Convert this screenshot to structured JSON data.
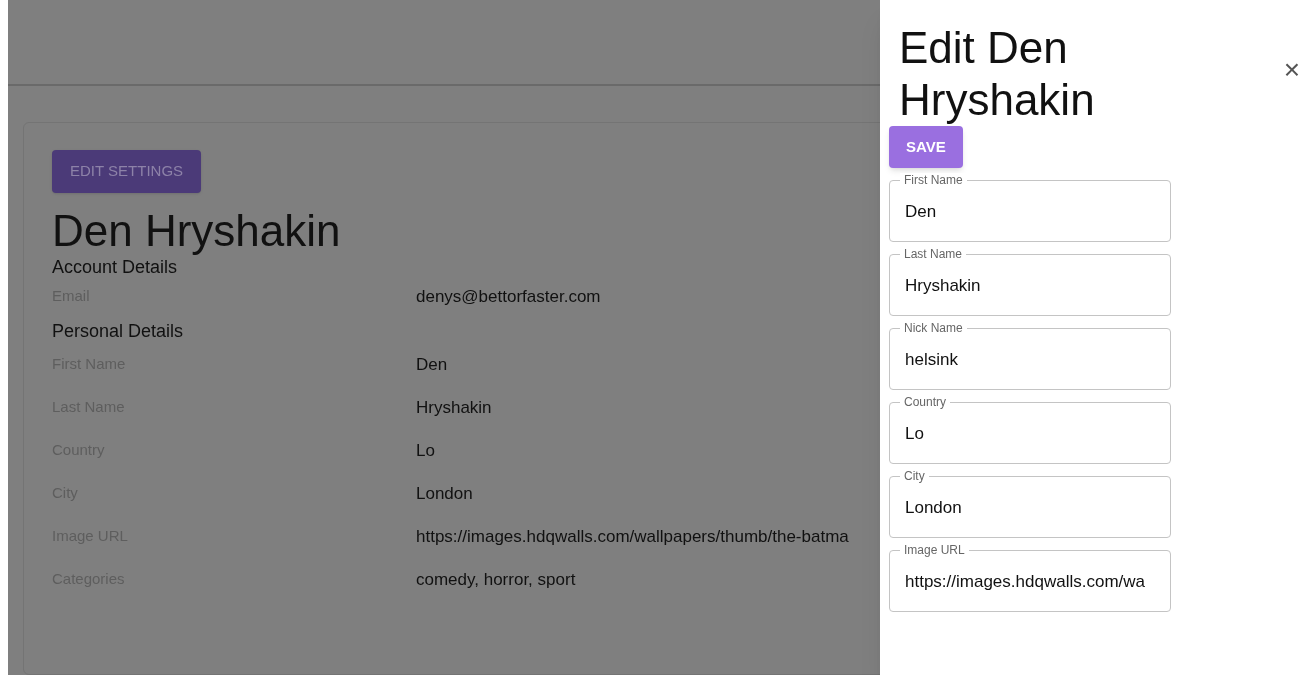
{
  "profile": {
    "edit_button": "EDIT SETTINGS",
    "name": "Den Hryshakin",
    "sections": [
      {
        "title": "Account Details",
        "rows": [
          {
            "label": "Email",
            "value": "denys@bettorfaster.com"
          }
        ]
      },
      {
        "title": "Personal Details",
        "rows": [
          {
            "label": "First Name",
            "value": "Den"
          },
          {
            "label": "Last Name",
            "value": "Hryshakin"
          },
          {
            "label": "Country",
            "value": "Lo"
          },
          {
            "label": "City",
            "value": "London"
          },
          {
            "label": "Image URL",
            "value": "https://images.hdqwalls.com/wallpapers/thumb/the-batma"
          },
          {
            "label": "Categories",
            "value": "comedy, horror, sport"
          }
        ]
      }
    ]
  },
  "drawer": {
    "title": "Edit Den Hryshakin",
    "close": "×",
    "save_button": "SAVE",
    "fields": [
      {
        "label": "First Name",
        "value": "Den"
      },
      {
        "label": "Last Name",
        "value": "Hryshakin"
      },
      {
        "label": "Nick Name",
        "value": "helsink"
      },
      {
        "label": "Country",
        "value": "Lo"
      },
      {
        "label": "City",
        "value": "London"
      },
      {
        "label": "Image URL",
        "value": "https://images.hdqwalls.com/wa"
      }
    ]
  }
}
